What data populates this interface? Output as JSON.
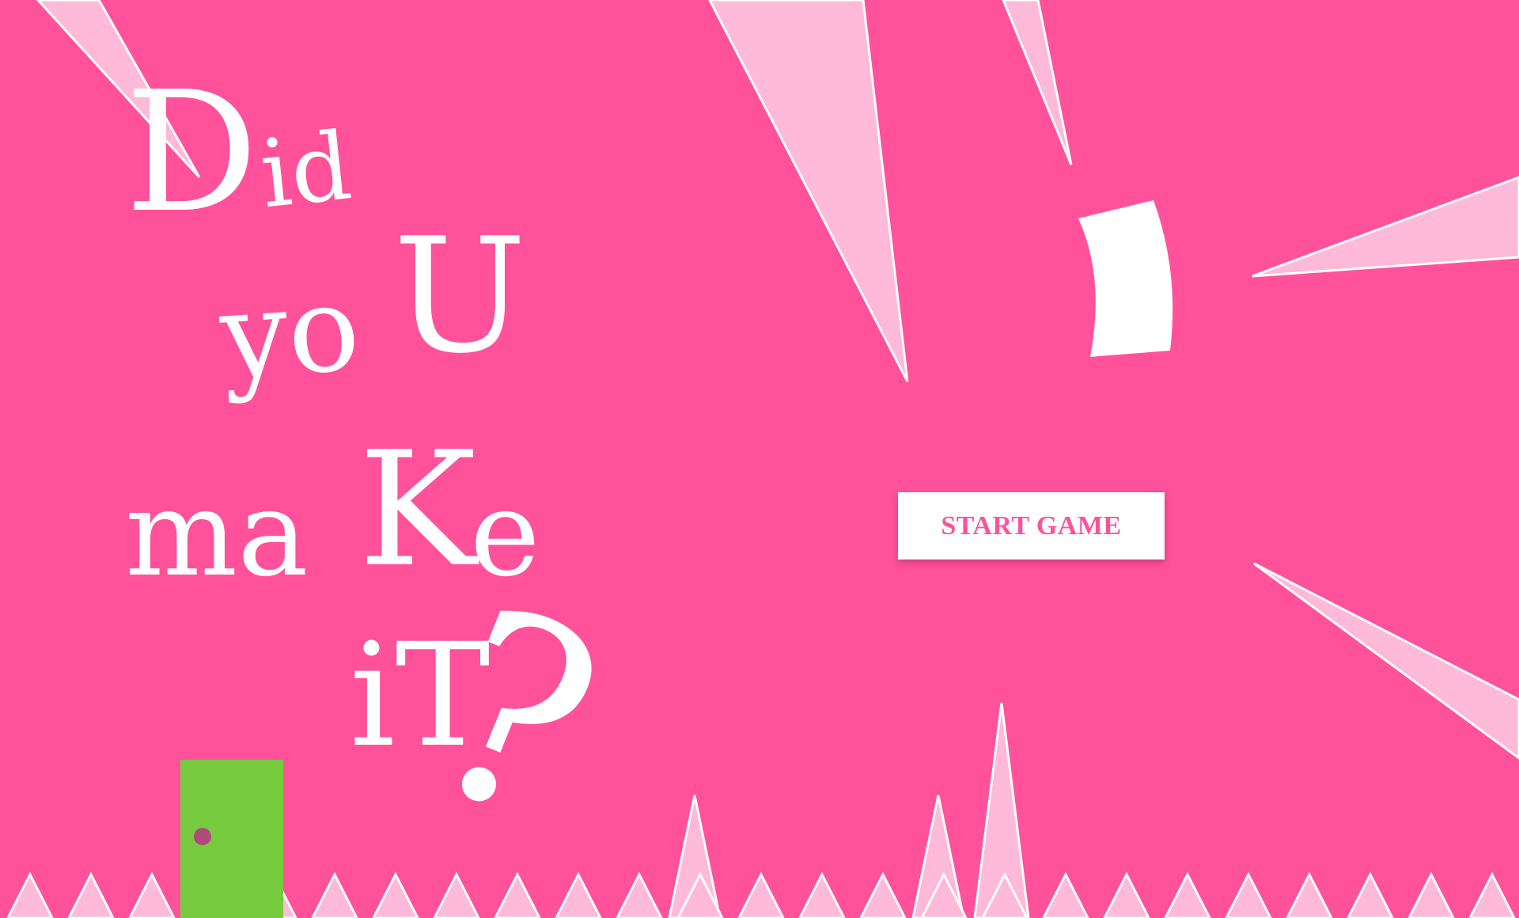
{
  "game": {
    "title": {
      "line1": [
        "D",
        "id"
      ],
      "line2": [
        "yo",
        "U"
      ],
      "line3": [
        "ma",
        "K",
        "e"
      ],
      "line4": [
        "iT",
        "?"
      ]
    },
    "start_button_label": "START GAME"
  },
  "colors": {
    "background": "#ff529b",
    "spike_fill": "#ffb9d9",
    "spike_outline": "#ffffff",
    "title_text": "#ffffff",
    "door": "#76cb3f",
    "door_knob": "#b04a7a",
    "button_bg": "#ffffff",
    "button_text": "#ff529b"
  },
  "icons": {
    "door": "exit-door-icon",
    "spikes": "spike-hazard-icon"
  }
}
